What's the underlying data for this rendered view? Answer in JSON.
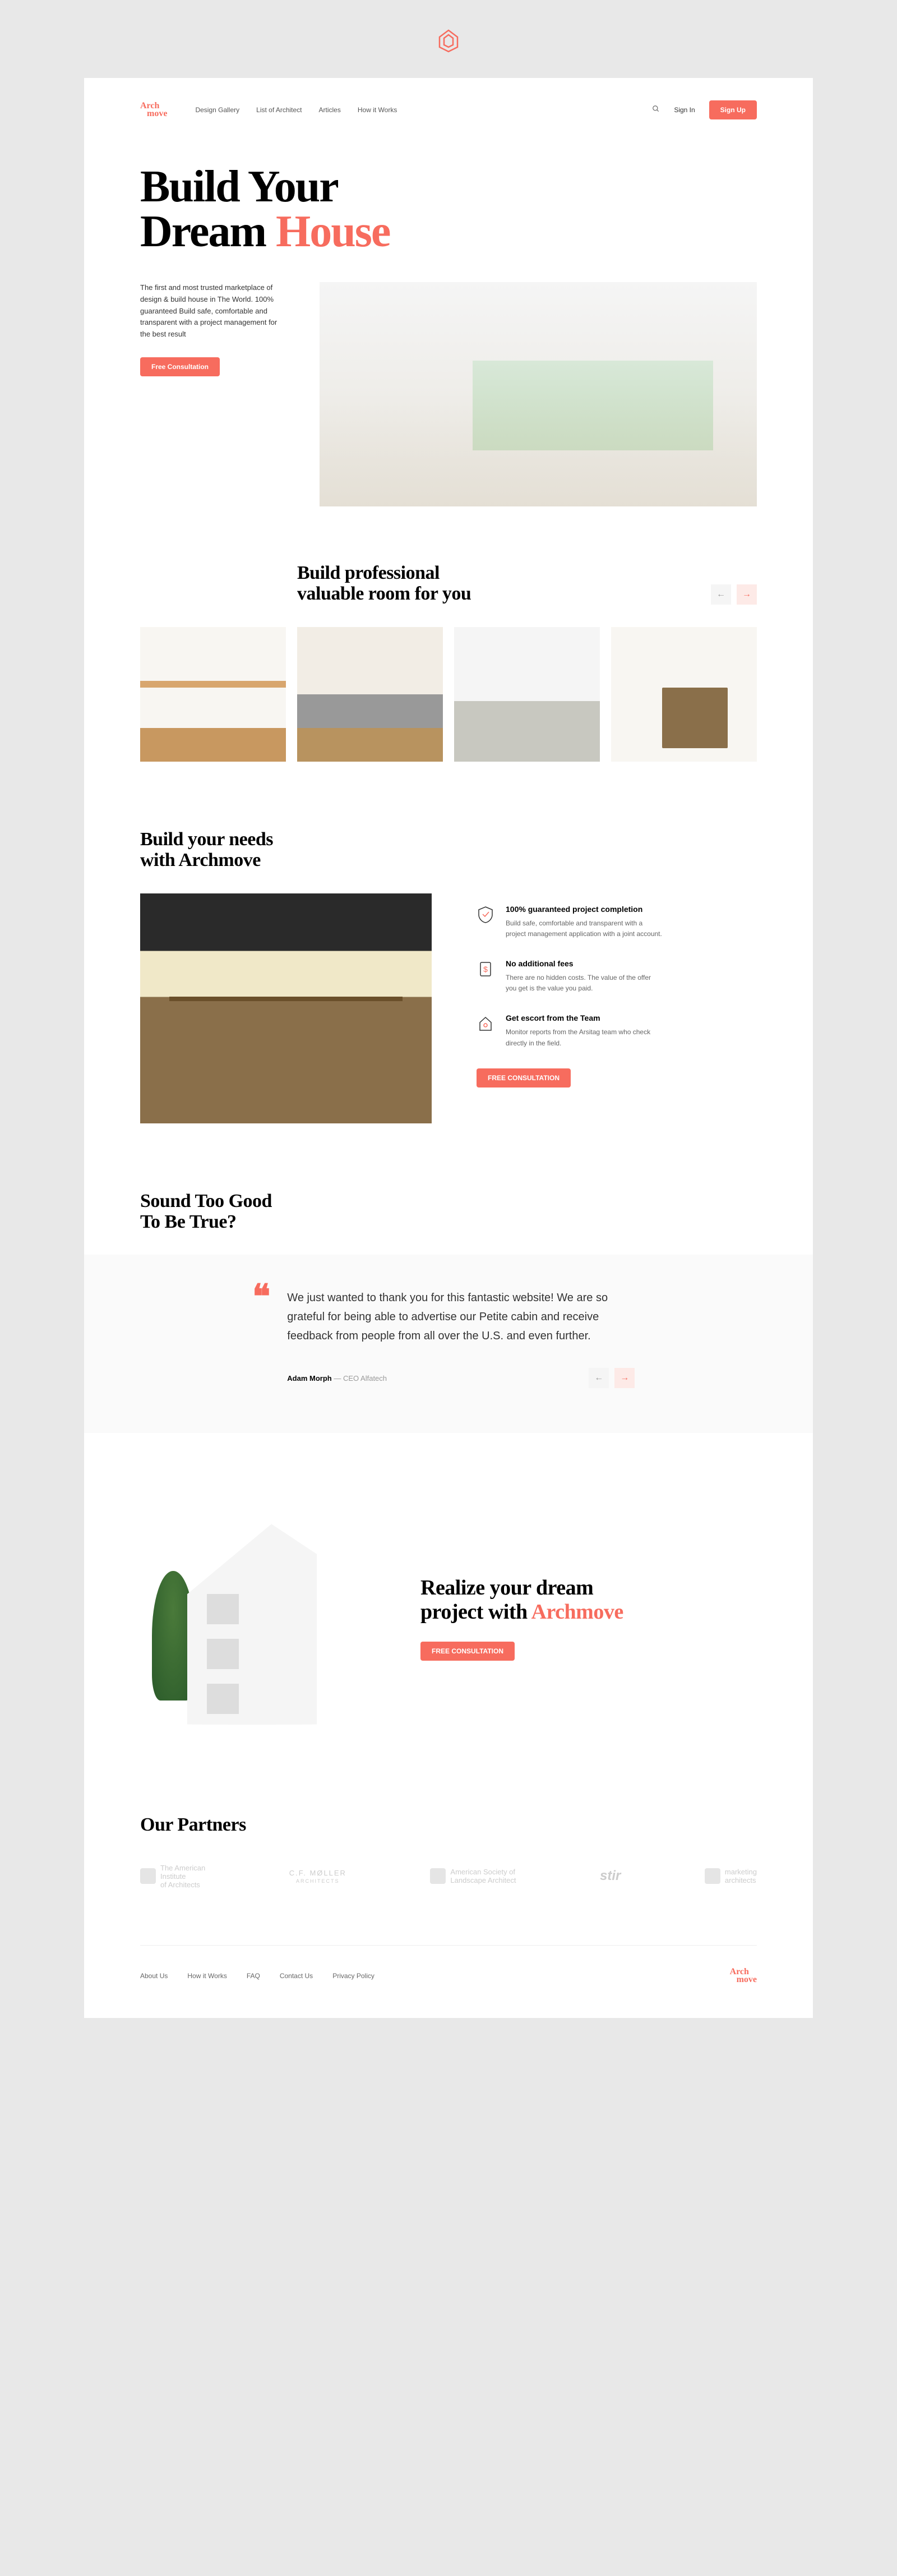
{
  "brand": {
    "line1": "Arch",
    "line2": "move"
  },
  "nav": {
    "item1": "Design Gallery",
    "item2": "List of Architect",
    "item3": "Articles",
    "item4": "How it Works"
  },
  "header": {
    "signin": "Sign In",
    "signup": "Sign Up"
  },
  "hero": {
    "title1": "Build Your",
    "title2": "Dream ",
    "title2accent": "House",
    "desc": "The first and most trusted marketplace of design & build house in The World. 100% guaranteed Build safe, comfortable and transparent with a project management for the best result",
    "cta": "Free Consultation"
  },
  "gallery": {
    "title1": "Build professional",
    "title2": "valuable room for you"
  },
  "needs": {
    "title1": "Build your needs",
    "title2": "with Archmove",
    "f1_title": "100% guaranteed project completion",
    "f1_desc": "Build safe, comfortable and transparent with a project management application with a joint account.",
    "f2_title": "No additional fees",
    "f2_desc": "There are no hidden costs. The value of the offer you get is the value you paid.",
    "f3_title": "Get escort from the Team",
    "f3_desc": "Monitor reports from the Arsitag team who check directly in the field.",
    "cta": "FREE CONSULTATION"
  },
  "testimonial": {
    "title1": "Sound Too Good",
    "title2": "To Be True?",
    "quote": "We just wanted to thank you for this fantastic website! We are so grateful for being able to advertise our Petite cabin and receive feedback from people from all over the U.S. and even further.",
    "author_name": "Adam Morph",
    "author_role": " — CEO Alfatech"
  },
  "cta": {
    "title1": "Realize your dream",
    "title2": "project with ",
    "title2accent": "Archmove",
    "button": "FREE CONSULTATION"
  },
  "partners": {
    "title": "Our Partners",
    "p1a": "The American",
    "p1b": "Institute",
    "p1c": "of Architects",
    "p2a": "C.F. MØLLER",
    "p2b": "ARCHITECTS",
    "p3a": "American Society of",
    "p3b": "Landscape Architect",
    "p4": "stir",
    "p5a": "marketing",
    "p5b": "architects"
  },
  "footer": {
    "l1": "About Us",
    "l2": "How it Works",
    "l3": "FAQ",
    "l4": "Contact Us",
    "l5": "Privacy Policy"
  }
}
